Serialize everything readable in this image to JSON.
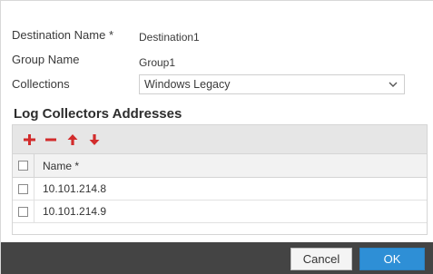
{
  "form": {
    "destination_name": {
      "label": "Destination Name *",
      "value": "Destination1"
    },
    "group_name": {
      "label": "Group Name",
      "value": "Group1"
    },
    "collections": {
      "label": "Collections",
      "value": "Windows Legacy"
    }
  },
  "log_collectors": {
    "title": "Log Collectors Addresses",
    "toolbar": {
      "add_icon": "plus-icon",
      "remove_icon": "minus-icon",
      "move_up_icon": "arrow-up-icon",
      "move_down_icon": "arrow-down-icon",
      "icon_color": "#d22c2c"
    },
    "columns": [
      "Name *"
    ],
    "rows": [
      {
        "name": "10.101.214.8"
      },
      {
        "name": "10.101.214.9"
      }
    ]
  },
  "footer": {
    "cancel_label": "Cancel",
    "ok_label": "OK",
    "background": "#444444",
    "ok_color": "#2e8fd6"
  }
}
